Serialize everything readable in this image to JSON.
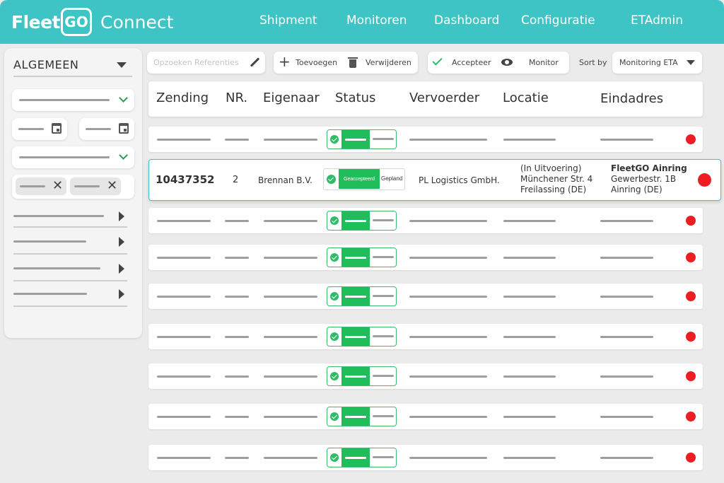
{
  "brand": {
    "fleet": "Fleet",
    "go": "GO",
    "connect": "Connect"
  },
  "nav": [
    "Shipment",
    "Monitoren",
    "Dashboard",
    "Configuratie",
    "ETAdmin"
  ],
  "sidebar": {
    "heading": "ALGEMEEN"
  },
  "toolbar": {
    "search_placeholder": "Opzoeken Referenties",
    "add_label": "Toevoegen",
    "delete_label": "Verwijderen",
    "accept_label": "Accepteer",
    "monitor_label": "Monitor",
    "sort_label": "Sort by",
    "sort_value": "Monitoring ETA"
  },
  "table": {
    "columns": [
      "Zending",
      "NR.",
      "Eigenaar",
      "Status",
      "Vervoerder",
      "Locatie",
      "Eindadres"
    ],
    "highlighted_row": {
      "zending": "10437352",
      "nr": "2",
      "eigenaar": "Brennan B.V.",
      "status_active": "Geaccepteerd",
      "status_next": "Gepland",
      "vervoerder": "PL Logistics GmbH.",
      "locatie_status": "(In Uitvoering)",
      "locatie_street": "Münchener Str. 4",
      "locatie_city": "Freilassing (DE)",
      "eind_name": "FleetGO Ainring",
      "eind_street": "Gewerbestr. 1B",
      "eind_city": "Ainring (DE)"
    },
    "placeholder_row_count": 8
  },
  "colors": {
    "header": "#3ec4c4",
    "accent_green": "#1fbe5a",
    "alert_red": "#ee1d23"
  }
}
